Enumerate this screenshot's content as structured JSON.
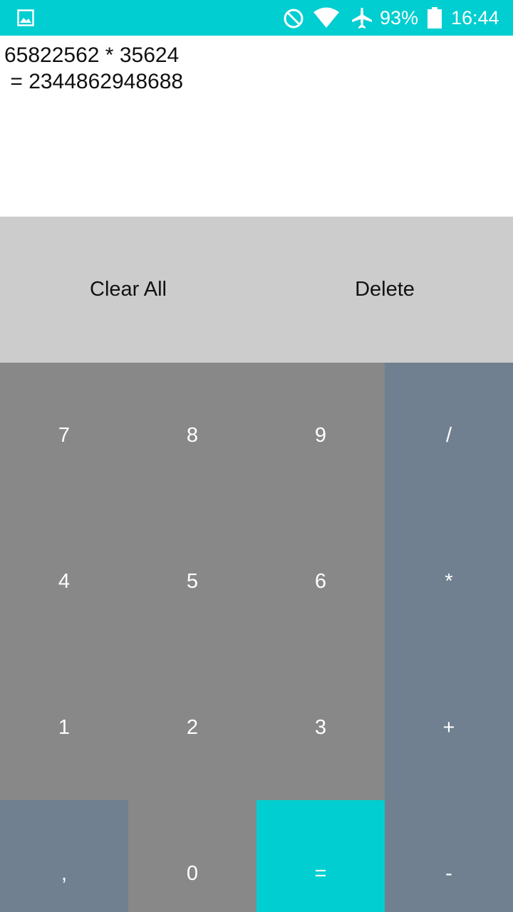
{
  "status_bar": {
    "battery": "93%",
    "time": "16:44",
    "icons": [
      "gallery-icon",
      "do-not-disturb-icon",
      "wifi-icon",
      "airplane-mode-icon",
      "battery-icon"
    ],
    "background": "#00CED1"
  },
  "display": {
    "expression": "65822562 * 35624",
    "result": " = 2344862948688"
  },
  "controls": {
    "clear_all": "Clear All",
    "delete": "Delete"
  },
  "keys": {
    "k7": "7",
    "k8": "8",
    "k9": "9",
    "div": "/",
    "k4": "4",
    "k5": "5",
    "k6": "6",
    "mul": "*",
    "k1": "1",
    "k2": "2",
    "k3": "3",
    "add": "+",
    "comma": ",",
    "k0": "0",
    "eq": "=",
    "sub": "-"
  },
  "colors": {
    "accent": "#00CED1",
    "number_key": "#888888",
    "operator_key": "#708090",
    "control_row": "#CCCCCC"
  }
}
